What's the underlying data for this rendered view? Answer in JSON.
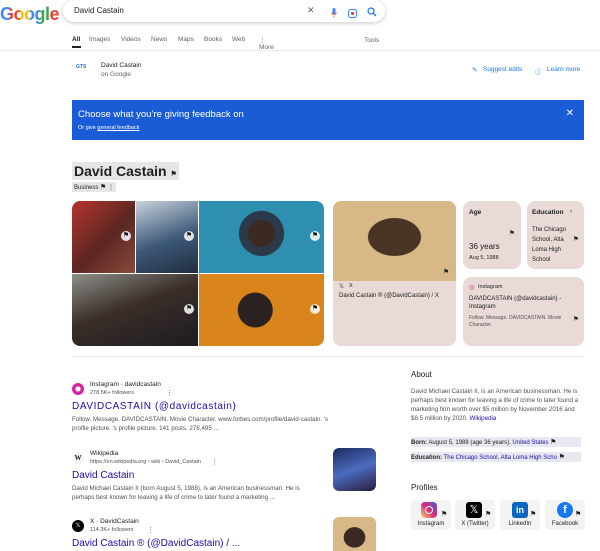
{
  "header": {
    "logo": "Google",
    "query": "David Castain",
    "tabs": [
      "All",
      "Images",
      "Videos",
      "News",
      "Maps",
      "Books",
      "Web",
      "⋮ More"
    ],
    "tools": "Tools"
  },
  "source_row": {
    "logo_text": "GTS",
    "name": "David Castain",
    "on": "on Google",
    "suggest_edits": "Suggest edits",
    "learn_more": "Learn more"
  },
  "feedback": {
    "title": "Choose what you’re giving feedback on",
    "sub_prefix": "Or give ",
    "sub_link": "general feedback"
  },
  "knowledge_panel": {
    "title": "David Castain",
    "subtitle": "Business"
  },
  "cards": {
    "x_post": "David Castain ® (@DavidCastain) / X",
    "x_label": "X",
    "age_label": "Age",
    "age_value": "36 years",
    "age_date": "Aug 5, 1988",
    "edu_label": "Education",
    "edu_value": "The Chicago School, Alta Loma High School",
    "ig_label": "Instagram",
    "ig_title": "DAVIDCASTAIN (@davidcastain) - Instagram",
    "ig_snip": "Follow. Message. DAVIDCASTAIN. Movie Character."
  },
  "results": [
    {
      "site": "Instagram · davidcastain",
      "meta": "278.5K+ followers",
      "title": "DAVIDCASTAIN (@davidcastain)",
      "snippet": "Follow. Message. DAVIDCASTAIN. Movie Character. www.forbes.com/profile/david-castain. 's profile picture. 's profile picture. 141 posts. 278,495 ..."
    },
    {
      "site": "Wikipedia",
      "meta": "https://en.wikipedia.org › wiki › David_Castain",
      "title": "David Castain",
      "snippet": "David Michael Castain II (born August 5, 1988), is an American businessman. He is perhaps best known for leaving a life of crime to later found a marketing ..."
    },
    {
      "site": "X · DavidCastain",
      "meta": "114.3K+ followers",
      "title": "David Castain ® (@DavidCastain) / ...",
      "snippet": ""
    }
  ],
  "about": {
    "heading": "About",
    "text": "David Michael Castain II, is an American businessman. He is perhaps best known for leaving a life of crime to later found a marketing firm worth over $5 million by November 2016 and $8.5 million by 2020.",
    "wiki": "Wikipedia",
    "born_label": "Born:",
    "born_value": "August 5, 1988 (age 36 years),",
    "born_link": "United States",
    "edu_label": "Education:",
    "edu_value": "The Chicago School, Alta Loma High Scho"
  },
  "profiles": {
    "heading": "Profiles",
    "items": [
      {
        "label": "Instagram",
        "icon": "instagram-icon"
      },
      {
        "label": "X (Twitter)",
        "icon": "x-icon"
      },
      {
        "label": "LinkedIn",
        "icon": "linkedin-icon"
      },
      {
        "label": "Facebook",
        "icon": "facebook-icon"
      }
    ]
  },
  "colors": {
    "accent": "#1a73e8",
    "banner": "#1a5cd6",
    "link": "#1a0dab",
    "card": "#e9dad7"
  }
}
